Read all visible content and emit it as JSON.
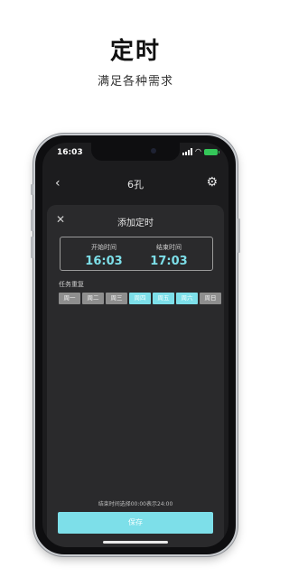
{
  "hero": {
    "title": "定时",
    "subtitle": "满足各种需求"
  },
  "status_bar": {
    "time": "16:03",
    "wifi_icon": "wifi-icon",
    "battery_icon": "battery-charging-icon",
    "battery_color": "#34c759"
  },
  "nav": {
    "back_icon": "‹",
    "title": "6孔",
    "settings_icon": "⚙"
  },
  "sheet": {
    "close_icon": "✕",
    "title": "添加定时",
    "start_label": "开始时间",
    "start_time": "16:03",
    "end_label": "结束时间",
    "end_time": "17:03",
    "repeat_label": "任务重复",
    "days": [
      {
        "label": "周一",
        "selected": false
      },
      {
        "label": "周二",
        "selected": false
      },
      {
        "label": "周三",
        "selected": false
      },
      {
        "label": "周四",
        "selected": true
      },
      {
        "label": "周五",
        "selected": true
      },
      {
        "label": "周六",
        "selected": true
      },
      {
        "label": "周日",
        "selected": false
      }
    ],
    "note": "结束时间选择00:00表示24:00",
    "save_label": "保存"
  },
  "colors": {
    "accent": "#7ddfe9",
    "day_off": "#8e8e8e",
    "sheet_bg": "#2a2a2c",
    "screen_bg": "#1c1c1e"
  }
}
